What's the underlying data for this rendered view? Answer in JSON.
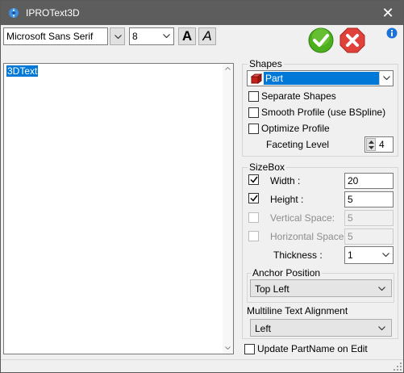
{
  "window": {
    "title": "IPROText3D",
    "close_glyph": "✕"
  },
  "toolbar": {
    "font_name": "Microsoft Sans Serif",
    "font_size": "8",
    "bold_label": "A",
    "italic_label": "A"
  },
  "editor": {
    "text": "3DText"
  },
  "shapes": {
    "label": "Shapes",
    "selected": "Part",
    "separate_shapes": {
      "label": "Separate Shapes",
      "checked": false
    },
    "smooth_profile": {
      "label": "Smooth Profile (use BSpline)",
      "checked": false
    },
    "optimize_profile": {
      "label": "Optimize Profile",
      "checked": false
    },
    "faceting_level": {
      "label": "Faceting Level",
      "value": "4"
    }
  },
  "sizebox": {
    "label": "SizeBox",
    "width": {
      "label": "Width :",
      "value": "20",
      "checked": true
    },
    "height": {
      "label": "Height :",
      "value": "5",
      "checked": true
    },
    "vertical_space": {
      "label": "Vertical Space:",
      "value": "5",
      "checked": false,
      "enabled": false
    },
    "horizontal_space": {
      "label": "Horizontal Space:",
      "value": "5",
      "checked": false,
      "enabled": false
    },
    "thickness": {
      "label": "Thickness :",
      "value": "1"
    },
    "anchor": {
      "label": "Anchor Position",
      "value": "Top Left"
    }
  },
  "multiline": {
    "label": "Multiline Text Alignment",
    "value": "Left"
  },
  "update_partname": {
    "label": "Update PartName on Edit",
    "checked": false
  },
  "colors": {
    "titlebar": "#5d5d5d",
    "ok_green": "#4caf1c",
    "cancel_red": "#e0413a",
    "selection": "#0078d7",
    "info_blue": "#1a73d9"
  }
}
